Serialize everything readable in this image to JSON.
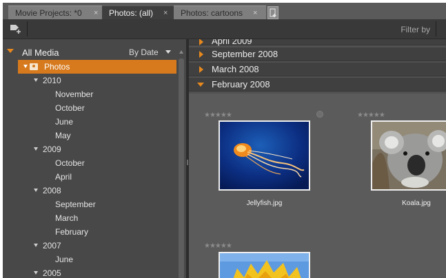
{
  "tabs": [
    {
      "label": "Movie Projects: *0",
      "close": "×"
    },
    {
      "label": "Photos: (all)",
      "close": "×"
    },
    {
      "label": "Photos: cartoons",
      "close": "×"
    }
  ],
  "toolbar": {
    "filter_label": "Filter by"
  },
  "left_panel": {
    "title": "All Media",
    "sort_label": "By Date",
    "tree": [
      {
        "label": "Photos",
        "level": 0,
        "expanded": true,
        "selected": true
      },
      {
        "label": "2010",
        "level": 1,
        "expanded": true
      },
      {
        "label": "November",
        "level": 2
      },
      {
        "label": "October",
        "level": 2
      },
      {
        "label": "June",
        "level": 2
      },
      {
        "label": "May",
        "level": 2
      },
      {
        "label": "2009",
        "level": 1,
        "expanded": true
      },
      {
        "label": "October",
        "level": 2
      },
      {
        "label": "April",
        "level": 2
      },
      {
        "label": "2008",
        "level": 1,
        "expanded": true
      },
      {
        "label": "September",
        "level": 2
      },
      {
        "label": "March",
        "level": 2
      },
      {
        "label": "February",
        "level": 2
      },
      {
        "label": "2007",
        "level": 1,
        "expanded": true
      },
      {
        "label": "June",
        "level": 2
      },
      {
        "label": "2005",
        "level": 1,
        "expanded": true
      }
    ]
  },
  "right_panel": {
    "groups": [
      {
        "label": "April 2009",
        "expanded": false
      },
      {
        "label": "September 2008",
        "expanded": false
      },
      {
        "label": "March 2008",
        "expanded": false
      },
      {
        "label": "February 2008",
        "expanded": true
      }
    ],
    "items": [
      {
        "caption": "Jellyfish.jpg",
        "stars": "★★★★★"
      },
      {
        "caption": "Koala.jpg",
        "stars": "★★★★★"
      },
      {
        "caption": "",
        "stars": "★★★★★"
      }
    ]
  },
  "colors": {
    "accent": "#d67a1d",
    "panel": "#484848",
    "tab_bar": "#5a5a5a"
  },
  "icons": {
    "toolbar_tag": "tag-add-icon",
    "tab_add": "new-tab-icon",
    "photo_folder": "photo-folder-icon",
    "info": "info-icon"
  }
}
